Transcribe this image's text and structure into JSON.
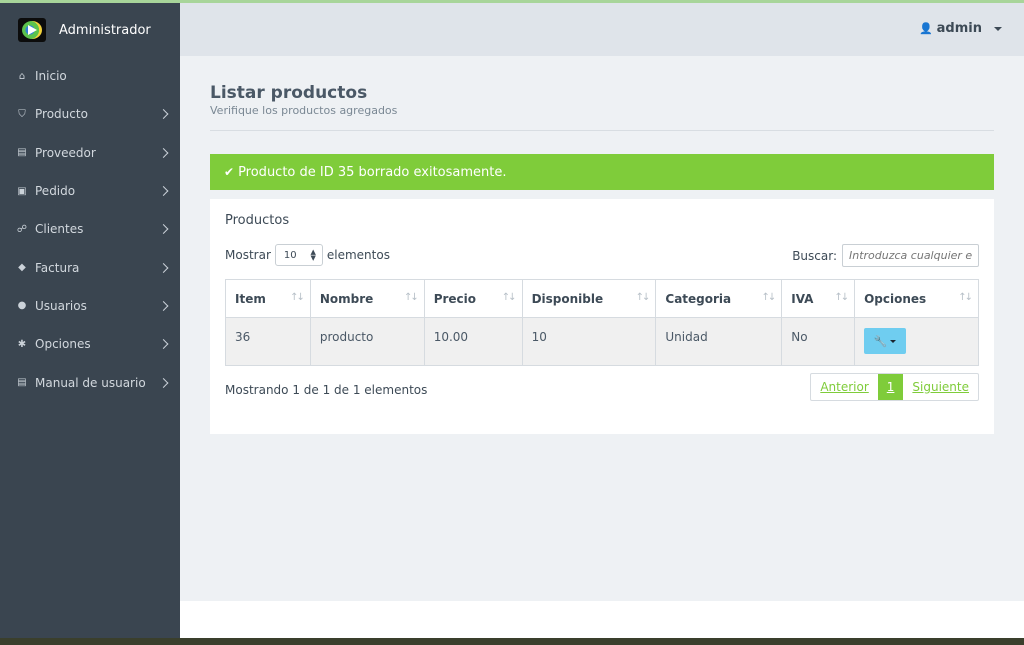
{
  "app": {
    "brand": "Administrador"
  },
  "header": {
    "user": "admin"
  },
  "sidebar": {
    "items": [
      {
        "label": "Inicio",
        "icon": "home-icon",
        "glyph": "⌂",
        "has_chevron": false
      },
      {
        "label": "Producto",
        "icon": "basket-icon",
        "glyph": "⛉",
        "has_chevron": true
      },
      {
        "label": "Proveedor",
        "icon": "book-icon",
        "glyph": "▤",
        "has_chevron": true
      },
      {
        "label": "Pedido",
        "icon": "gift-icon",
        "glyph": "▣",
        "has_chevron": true
      },
      {
        "label": "Clientes",
        "icon": "handshake-icon",
        "glyph": "☍",
        "has_chevron": true
      },
      {
        "label": "Factura",
        "icon": "tag-icon",
        "glyph": "◆",
        "has_chevron": true
      },
      {
        "label": "Usuarios",
        "icon": "users-icon",
        "glyph": "●",
        "has_chevron": true
      },
      {
        "label": "Opciones",
        "icon": "gear-icon",
        "glyph": "✱",
        "has_chevron": true
      },
      {
        "label": "Manual de usuario",
        "icon": "book-icon",
        "glyph": "▤",
        "has_chevron": true
      }
    ]
  },
  "page": {
    "title": "Listar productos",
    "subtitle": "Verifique los productos agregados",
    "alert": "Producto de ID 35 borrado exitosamente."
  },
  "panel": {
    "title": "Productos",
    "show_label": "Mostrar",
    "show_value": "10",
    "elements_label": "elementos",
    "search_label": "Buscar:",
    "search_placeholder": "Introduzca cualquier elemento",
    "columns": [
      "Item",
      "Nombre",
      "Precio",
      "Disponible",
      "Categoria",
      "IVA",
      "Opciones"
    ],
    "rows": [
      {
        "item": "36",
        "nombre": "producto",
        "precio": "10.00",
        "disponible": "10",
        "categoria": "Unidad",
        "iva": "No"
      }
    ],
    "info": "Mostrando 1 de 1 de 1 elementos",
    "pager": {
      "prev": "Anterior",
      "current": "1",
      "next": "Siguiente"
    }
  },
  "colors": {
    "sidebar_bg": "#3a4550",
    "success": "#7fcc3a",
    "options_button": "#6fcdf0",
    "content_bg": "#eef1f4"
  }
}
